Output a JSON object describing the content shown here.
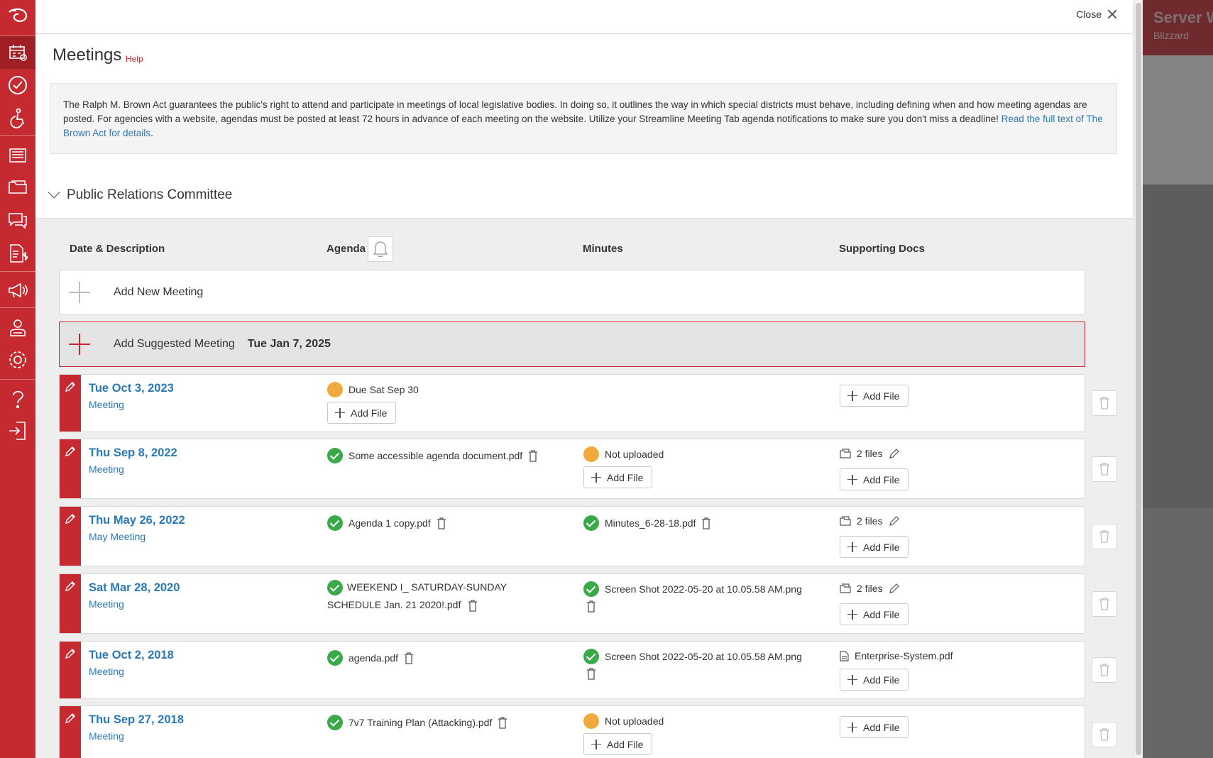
{
  "sidebar": {
    "icons": [
      "streamline-logo-icon",
      "meetings-icon",
      "checklist-icon",
      "accessibility-icon",
      "documents-icon",
      "folder-icon",
      "messages-icon",
      "finance-icon",
      "announcements-icon",
      "users-icon",
      "settings-icon",
      "help-icon",
      "logout-icon"
    ],
    "active": "meetings-icon",
    "color": "#c52a30"
  },
  "background_app": {
    "title": "Server W",
    "subtitle": "Blizzard"
  },
  "modal": {
    "close_label": "Close",
    "title": "Meetings",
    "help_label": "Help",
    "info_text": "The Ralph M. Brown Act guarantees the public's right to attend and participate in meetings of local legislative bodies. In doing so, it outlines the way in which special districts must behave, including defining when and how meeting agendas are posted. For agencies with a website, agendas must be posted at least 72 hours in advance of each meeting on the website. Utilize your Streamline Meeting Tab agenda notifications to make sure you don't miss a deadline! ",
    "info_link": "Read the full text of The Brown Act for details",
    "info_suffix": "."
  },
  "committee": {
    "name": "Public Relations Committee"
  },
  "columns": {
    "date": "Date & Description",
    "agenda": "Agenda",
    "minutes": "Minutes",
    "supporting": "Supporting Docs"
  },
  "add_new_label": "Add New Meeting",
  "suggested": {
    "label": "Add Suggested Meeting",
    "date": "Tue Jan 7, 2025"
  },
  "add_file_label": "Add File",
  "meetings": [
    {
      "date": "Tue Oct 3, 2023",
      "desc": "Meeting",
      "agenda": {
        "status": "orange",
        "text": "Due Sat Sep 30"
      },
      "supporting": {}
    },
    {
      "date": "Thu Sep 8, 2022",
      "desc": "Meeting",
      "agenda": {
        "status": "green",
        "text": "Some accessible agenda document.pdf"
      },
      "minutes": {
        "status": "orange",
        "text": "Not uploaded"
      },
      "supporting": {
        "files": "2 files"
      }
    },
    {
      "date": "Thu May 26, 2022",
      "desc": "May Meeting",
      "agenda": {
        "status": "green",
        "text": "Agenda 1 copy.pdf"
      },
      "minutes": {
        "status": "green",
        "text": "Minutes_6-28-18.pdf"
      },
      "supporting": {
        "files": "2 files"
      }
    },
    {
      "date": "Sat Mar 28, 2020",
      "desc": "Meeting",
      "agenda": {
        "status": "green",
        "text": "WEEKEND I_ SATURDAY-SUNDAY SCHEDULE Jan. 21 2020!.pdf"
      },
      "minutes": {
        "status": "green",
        "text": "Screen Shot 2022-05-20 at 10.05.58 AM.png"
      },
      "supporting": {
        "files": "2 files"
      }
    },
    {
      "date": "Tue Oct 2, 2018",
      "desc": "Meeting",
      "agenda": {
        "status": "green",
        "text": "agenda.pdf"
      },
      "minutes": {
        "status": "green",
        "text": "Screen Shot 2022-05-20 at 10.05.58 AM.png"
      },
      "supporting": {
        "file": "Enterprise-System.pdf"
      }
    },
    {
      "date": "Thu Sep 27, 2018",
      "desc": "Meeting",
      "agenda": {
        "status": "green",
        "text": "7v7 Training Plan (Attacking).pdf"
      },
      "minutes": {
        "status": "orange",
        "text": "Not uploaded"
      },
      "supporting": {}
    }
  ]
}
